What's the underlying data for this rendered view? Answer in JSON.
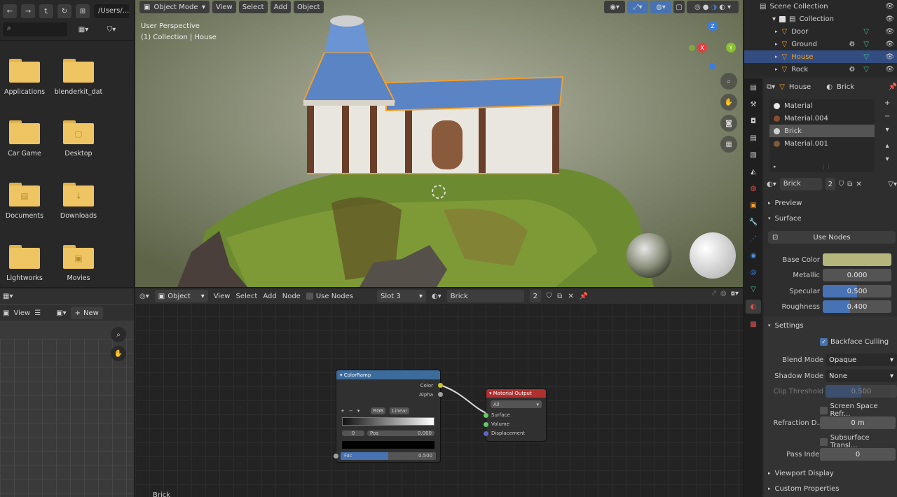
{
  "file_browser": {
    "path": "/Users/...",
    "folders": [
      {
        "name": "Applications",
        "icon": "folder-icon"
      },
      {
        "name": "blenderkit_dat",
        "icon": "folder-icon"
      },
      {
        "name": "Car Game",
        "icon": "folder-icon"
      },
      {
        "name": "Desktop",
        "icon": "folder-icon"
      },
      {
        "name": "Documents",
        "icon": "folder-icon"
      },
      {
        "name": "Downloads",
        "icon": "folder-icon"
      },
      {
        "name": "Lightworks",
        "icon": "folder-icon"
      },
      {
        "name": "Movies",
        "icon": "folder-icon"
      }
    ]
  },
  "viewport": {
    "mode": "Object Mode",
    "menu": [
      "View",
      "Select",
      "Add",
      "Object"
    ],
    "info_line1": "User Perspective",
    "info_line2": "(1) Collection | House",
    "gizmo": {
      "x": "X",
      "y": "Y",
      "z": "Z"
    }
  },
  "node_editor": {
    "editor_type": "Object",
    "menu": [
      "View",
      "Select",
      "Add",
      "Node"
    ],
    "use_nodes": "Use Nodes",
    "slot": "Slot 3",
    "material": "Brick",
    "users": "2",
    "footer_label": "Brick",
    "colorramp": {
      "title": "ColorRamp",
      "out_color": "Color",
      "out_alpha": "Alpha",
      "mode": "RGB",
      "interp": "Linear",
      "index": "0",
      "pos_label": "Pos",
      "pos_value": "0.000",
      "fac_label": "Fac",
      "fac_value": "0.500"
    },
    "material_output": {
      "title": "Material Output",
      "target": "All",
      "inputs": [
        "Surface",
        "Volume",
        "Displacement"
      ]
    }
  },
  "image_editor": {
    "view": "View",
    "new": "New"
  },
  "outliner": {
    "title": "Scene Collection",
    "items": [
      {
        "name": "Collection",
        "level": 1
      },
      {
        "name": "Door",
        "level": 2
      },
      {
        "name": "Ground",
        "level": 2
      },
      {
        "name": "House",
        "level": 2,
        "selected": true
      },
      {
        "name": "Rock",
        "level": 2
      }
    ]
  },
  "properties": {
    "object": "House",
    "material": "Brick",
    "slots": [
      "Material",
      "Material.004",
      "Brick",
      "Material.001"
    ],
    "selected_slot": "Brick",
    "datablock": "Brick",
    "users": "2",
    "panels": {
      "preview": "Preview",
      "surface": "Surface",
      "settings": "Settings",
      "viewport_display": "Viewport Display",
      "custom_properties": "Custom Properties"
    },
    "use_nodes": "Use Nodes",
    "surface": [
      {
        "label": "Base Color",
        "value": "",
        "kind": "color"
      },
      {
        "label": "Metallic",
        "value": "0.000",
        "fill": 0
      },
      {
        "label": "Specular",
        "value": "0.500",
        "fill": 0.5
      },
      {
        "label": "Roughness",
        "value": "0.400",
        "fill": 0.4
      }
    ],
    "settings": {
      "backface_culling": "Backface Culling",
      "blend_mode_label": "Blend Mode",
      "blend_mode": "Opaque",
      "shadow_mode_label": "Shadow Mode",
      "shadow_mode": "None",
      "clip_label": "Clip Threshold",
      "clip_value": "0.500",
      "screen_space": "Screen Space Refr...",
      "refraction_label": "Refraction D...",
      "refraction_value": "0 m",
      "subsurface": "Subsurface Transl...",
      "pass_label": "Pass Index",
      "pass_value": "0"
    }
  },
  "colors": {
    "accent": "#4772b3",
    "selection_outline": "#f0a030",
    "base_color": "#b5b67c",
    "node_header_ramp": "#3c6c9c",
    "node_header_output": "#b03030"
  }
}
